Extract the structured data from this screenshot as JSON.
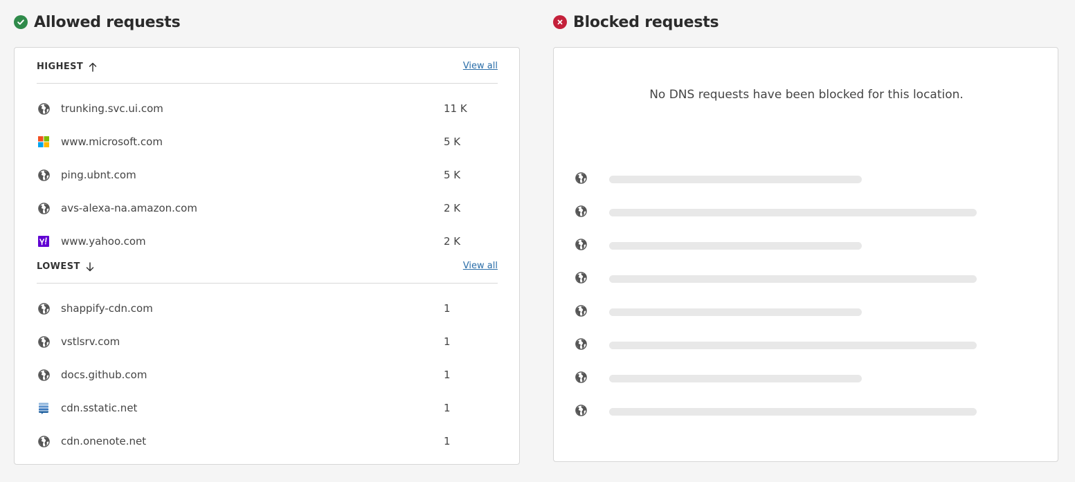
{
  "allowed": {
    "title": "Allowed requests",
    "highest": {
      "label": "HIGHEST",
      "view_all": "View all",
      "rows": [
        {
          "domain": "trunking.svc.ui.com",
          "count": "11 K",
          "icon": "globe-icon"
        },
        {
          "domain": "www.microsoft.com",
          "count": "5 K",
          "icon": "microsoft-logo-icon"
        },
        {
          "domain": "ping.ubnt.com",
          "count": "5 K",
          "icon": "globe-icon"
        },
        {
          "domain": "avs-alexa-na.amazon.com",
          "count": "2 K",
          "icon": "globe-icon"
        },
        {
          "domain": "www.yahoo.com",
          "count": "2 K",
          "icon": "yahoo-logo-icon"
        }
      ]
    },
    "lowest": {
      "label": "LOWEST",
      "view_all": "View all",
      "rows": [
        {
          "domain": "shappify-cdn.com",
          "count": "1",
          "icon": "globe-icon"
        },
        {
          "domain": "vstlsrv.com",
          "count": "1",
          "icon": "globe-icon"
        },
        {
          "domain": "docs.github.com",
          "count": "1",
          "icon": "globe-icon"
        },
        {
          "domain": "cdn.sstatic.net",
          "count": "1",
          "icon": "stackexchange-logo-icon"
        },
        {
          "domain": "cdn.onenote.net",
          "count": "1",
          "icon": "globe-icon"
        }
      ]
    }
  },
  "blocked": {
    "title": "Blocked requests",
    "empty_message": "No DNS requests have been blocked for this location."
  },
  "colors": {
    "allowed_accent": "#2f8a4a",
    "blocked_accent": "#c4203a",
    "link": "#2a6da8"
  }
}
